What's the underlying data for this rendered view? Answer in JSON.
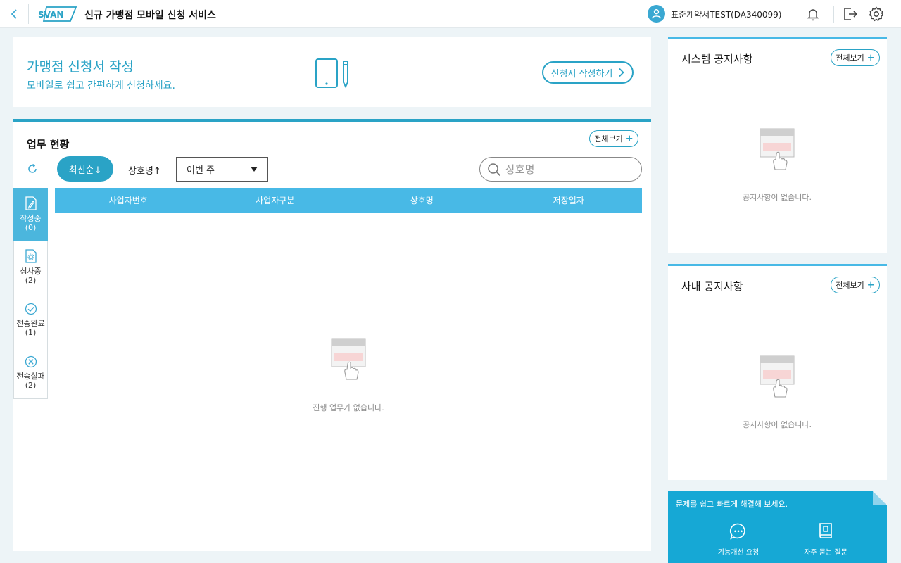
{
  "header": {
    "logo_text": "SVAN",
    "title": "신규 가맹점 모바일 신청 서비스",
    "user_name": "표준계약서TEST(DA340099)"
  },
  "banner": {
    "title": "가맹점 신청서 작성",
    "subtitle": "모바일로 쉽고 간편하게 신청하세요.",
    "button_label": "신청서 작성하기"
  },
  "work": {
    "title": "업무 현황",
    "view_all_label": "전체보기",
    "sort_latest_label": "최신순↓",
    "sort_name_label": "상호명↑",
    "period_selected": "이번 주",
    "search_placeholder": "상호명",
    "status_tabs": [
      {
        "label": "작성중",
        "count": "(0)",
        "icon": "document-pencil-icon"
      },
      {
        "label": "심사중",
        "count": "(2)",
        "icon": "document-gear-icon"
      },
      {
        "label": "전송완료",
        "count": "(1)",
        "icon": "check-circle-icon"
      },
      {
        "label": "전송실패",
        "count": "(2)",
        "icon": "x-circle-icon"
      }
    ],
    "columns": [
      "사업자번호",
      "사업자구분",
      "상호명",
      "저장일자"
    ],
    "empty_text": "진행 업무가 없습니다."
  },
  "system_notice": {
    "title": "시스템 공지사항",
    "view_all_label": "전체보기",
    "empty_text": "공지사항이 없습니다."
  },
  "company_notice": {
    "title": "사내 공지사항",
    "view_all_label": "전체보기",
    "empty_text": "공지사항이 없습니다."
  },
  "help": {
    "text": "문제를 쉽고 빠르게 해결해 보세요.",
    "items": [
      {
        "label": "기능개선 요청",
        "icon": "chat-bubble-icon"
      },
      {
        "label": "자주 묻는 질문",
        "icon": "book-icon"
      }
    ]
  },
  "colors": {
    "accent": "#2aa3c6",
    "table_header": "#48b9e6",
    "active_tab": "#4bb6dd",
    "help_bg": "#16a8d5"
  }
}
